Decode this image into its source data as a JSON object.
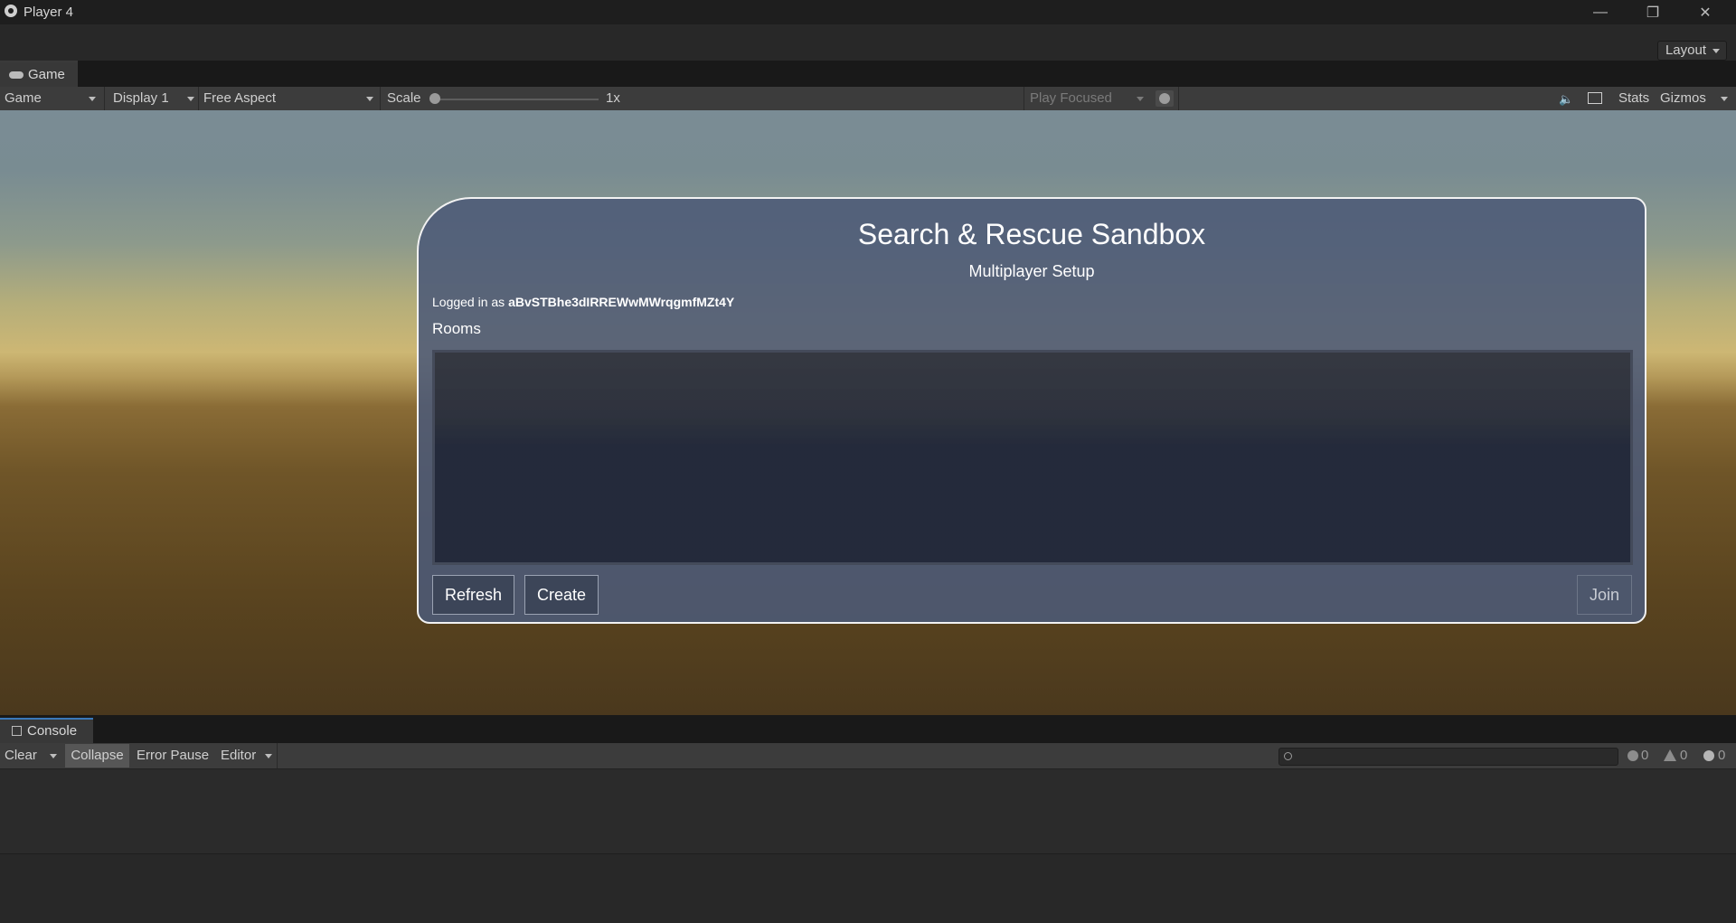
{
  "window": {
    "title": "Player 4",
    "minimize": "—",
    "restore": "❐",
    "close": "✕"
  },
  "toolbar": {
    "layout_label": "Layout"
  },
  "game_tab": {
    "label": "Game"
  },
  "game_toolbar": {
    "mode": "Game",
    "display": "Display 1",
    "aspect": "Free Aspect",
    "scale_label": "Scale",
    "scale_value": "1x",
    "play_mode": "Play Focused",
    "stats": "Stats",
    "gizmos": "Gizmos"
  },
  "panel": {
    "title": "Search & Rescue Sandbox",
    "subtitle": "Multiplayer Setup",
    "logged_in_prefix": "Logged in as ",
    "username": "aBvSTBhe3dIRREWwMWrqgmfMZt4Y",
    "rooms_label": "Rooms",
    "refresh_label": "Refresh",
    "create_label": "Create",
    "join_label": "Join"
  },
  "console_tab": {
    "label": "Console"
  },
  "console_toolbar": {
    "clear": "Clear",
    "collapse": "Collapse",
    "error_pause": "Error Pause",
    "editor": "Editor",
    "search_placeholder": "",
    "info_count": "0",
    "warning_count": "0",
    "error_count": "0"
  }
}
